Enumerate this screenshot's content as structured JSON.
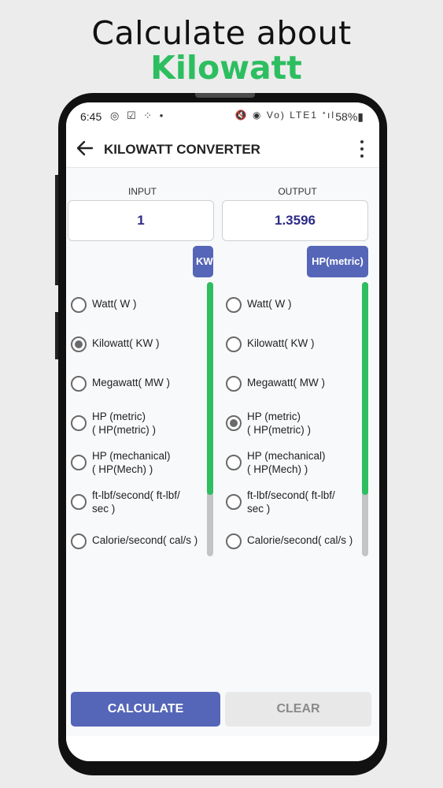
{
  "promo": {
    "line1": "Calculate about",
    "line2": "Kilowatt"
  },
  "status_bar": {
    "time": "6:45",
    "left_icons": "◎ ☑ ⁘ •",
    "right_icons": "🔇 ◉ Vo) LTE1 ᐩıl",
    "battery": "58%▮"
  },
  "app_bar": {
    "title": "KILOWATT CONVERTER",
    "back_icon": "arrow-left-icon",
    "menu_icon": "more-vert-icon"
  },
  "input_panel": {
    "label": "INPUT",
    "value": "1",
    "unit_chip": "KW"
  },
  "output_panel": {
    "label": "OUTPUT",
    "value": "1.3596",
    "unit_chip": "HP(metric)"
  },
  "input_units": [
    {
      "label": "Watt( W )",
      "checked": false
    },
    {
      "label": "Kilowatt( KW )",
      "checked": true
    },
    {
      "label": "Megawatt( MW )",
      "checked": false
    },
    {
      "label": "HP (metric)\n( HP(metric) )",
      "checked": false
    },
    {
      "label": "HP (mechanical)\n( HP(Mech) )",
      "checked": false
    },
    {
      "label": "ft-lbf/second( ft-lbf/\nsec )",
      "checked": false
    },
    {
      "label": "Calorie/second( cal/s )",
      "checked": false
    }
  ],
  "output_units": [
    {
      "label": "Watt( W )",
      "checked": false
    },
    {
      "label": "Kilowatt( KW )",
      "checked": false
    },
    {
      "label": "Megawatt( MW )",
      "checked": false
    },
    {
      "label": "HP (metric)\n( HP(metric) )",
      "checked": true
    },
    {
      "label": "HP (mechanical)\n( HP(Mech) )",
      "checked": false
    },
    {
      "label": "ft-lbf/second( ft-lbf/\nsec )",
      "checked": false
    },
    {
      "label": "Calorie/second( cal/s )",
      "checked": false
    }
  ],
  "buttons": {
    "calculate": "CALCULATE",
    "clear": "CLEAR"
  },
  "colors": {
    "accent": "#5565b7",
    "green": "#2dbe60",
    "output_text": "#2d2a86"
  }
}
